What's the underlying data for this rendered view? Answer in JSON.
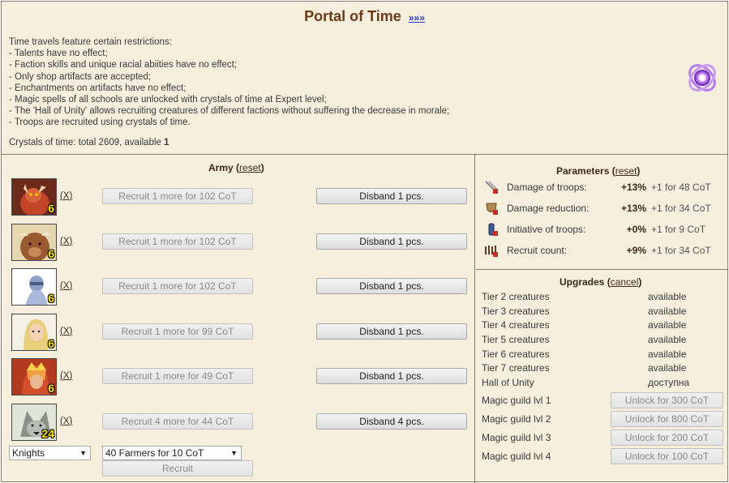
{
  "header": {
    "title": "Portal of Time",
    "more_link": "»»»",
    "restrictions": [
      "Time travels feature certain restrictions:",
      "- Talents have no effect;",
      "- Faction skills and unique racial abiities have no effect;",
      "- Only shop artifacts are accepted;",
      "- Enchantments on artifacts have no effect;",
      "- Magic spells of all schools are unlocked with crystals of time at Expert level;",
      "- The 'Hall of Unity' allows recruiting creatures of different factions without suffering the decrease in morale;",
      "- Troops are recruited using crystals of time."
    ],
    "crystals_prefix": "Crystals of time: total 2609, available ",
    "crystals_available": "1"
  },
  "army": {
    "title": "Army",
    "reset_label": "reset",
    "remove_label": "X",
    "units": [
      {
        "count": "6",
        "recruit_label": "Recruit 1 more for 102 CoT",
        "disband_label": "Disband 1 pcs."
      },
      {
        "count": "6",
        "recruit_label": "Recruit 1 more for 102 CoT",
        "disband_label": "Disband 1 pcs."
      },
      {
        "count": "6",
        "recruit_label": "Recruit 1 more for 102 CoT",
        "disband_label": "Disband 1 pcs."
      },
      {
        "count": "6",
        "recruit_label": "Recruit 1 more for 99 CoT",
        "disband_label": "Disband 1 pcs."
      },
      {
        "count": "6",
        "recruit_label": "Recruit 1 more for 49 CoT",
        "disband_label": "Disband 1 pcs."
      },
      {
        "count": "24",
        "recruit_label": "Recruit 4 more for 44 CoT",
        "disband_label": "Disband 4 pcs."
      }
    ],
    "faction_select": "Knights",
    "creature_select": "40 Farmers for 10 CoT",
    "recruit_button": "Recruit"
  },
  "parameters": {
    "title": "Parameters",
    "reset_label": "reset",
    "items": [
      {
        "name": "Damage of troops:",
        "value": "+13%",
        "cost": "+1 for 48 CoT",
        "icon": "sword-icon"
      },
      {
        "name": "Damage reduction:",
        "value": "+13%",
        "cost": "+1 for 34 CoT",
        "icon": "shield-icon"
      },
      {
        "name": "Initiative of troops:",
        "value": "+0%",
        "cost": "+1 for 9 CoT",
        "icon": "potion-icon"
      },
      {
        "name": "Recruit count:",
        "value": "+9%",
        "cost": "+1 for 34 CoT",
        "icon": "troops-icon"
      }
    ]
  },
  "upgrades": {
    "title": "Upgrades",
    "cancel_label": "cancel",
    "items": [
      {
        "name": "Tier 2 creatures",
        "status": "available"
      },
      {
        "name": "Tier 3 creatures",
        "status": "available"
      },
      {
        "name": "Tier 4 creatures",
        "status": "available"
      },
      {
        "name": "Tier 5 creatures",
        "status": "available"
      },
      {
        "name": "Tier 6 creatures",
        "status": "available"
      },
      {
        "name": "Tier 7 creatures",
        "status": "available"
      },
      {
        "name": "Hall of Unity",
        "status": "доступна"
      }
    ],
    "guilds": [
      {
        "name": "Magic guild lvl 1",
        "button": "Unlock for 300 CoT"
      },
      {
        "name": "Magic guild lvl 2",
        "button": "Unlock for 800 CoT"
      },
      {
        "name": "Magic guild lvl 3",
        "button": "Unlock for 200 CoT"
      },
      {
        "name": "Magic guild lvl 4",
        "button": "Unlock for 100 CoT"
      }
    ]
  }
}
